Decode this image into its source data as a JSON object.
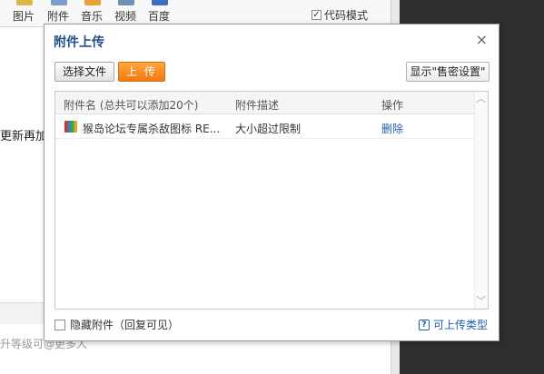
{
  "editor": {
    "toolbar": [
      {
        "label": "图片",
        "icon": "image-icon",
        "color": "#d9b84a"
      },
      {
        "label": "附件",
        "icon": "attachment-icon",
        "color": "#7a9ec9"
      },
      {
        "label": "音乐",
        "icon": "music-icon",
        "color": "#e8a23a"
      },
      {
        "label": "视频",
        "icon": "video-icon",
        "color": "#6f8fb5"
      },
      {
        "label": "百度",
        "icon": "baidu-icon",
        "color": "#3b6fc0"
      }
    ],
    "code_mode_label": "代码模式",
    "code_mode_checked": true,
    "partial_text": "更新再加",
    "bottom_hint": "升等级可@更多人"
  },
  "dialog": {
    "title": "附件上传",
    "close_symbol": "×",
    "select_file_label": "选择文件",
    "upload_label": "上 传",
    "show_sale_label": "显示\"售密设置\"",
    "table": {
      "col_name": "附件名 (总共可以添加20个)",
      "col_desc": "附件描述",
      "col_action": "操作",
      "rows": [
        {
          "name": "猴岛论坛专属杀敌图标 RE...",
          "desc": "大小超过限制",
          "action": "删除"
        }
      ]
    },
    "hide_attachment_label": "隐藏附件（回复可见）",
    "hide_attachment_checked": false,
    "upload_types_label": "可上传类型",
    "help_symbol": "?"
  },
  "colors": {
    "title": "#1f4f84",
    "link": "#1e5fa8",
    "upload_button": "#f07a10"
  }
}
